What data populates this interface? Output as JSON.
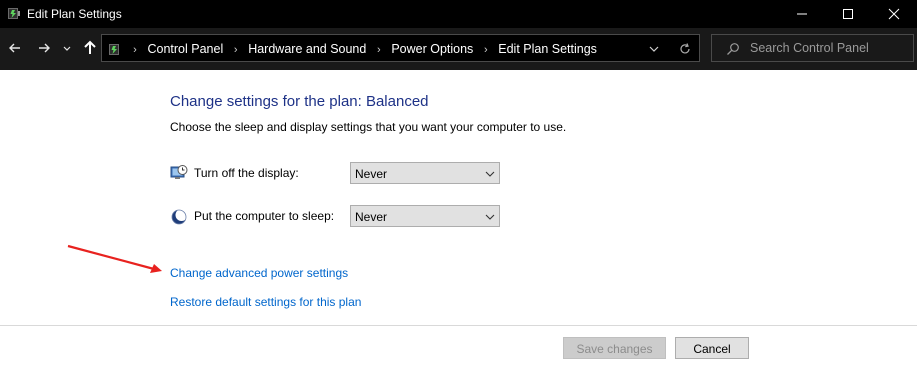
{
  "window": {
    "title": "Edit Plan Settings",
    "icons": {
      "app": "power-options-icon",
      "minimize": "minimize-icon",
      "maximize": "maximize-icon",
      "close": "close-icon"
    }
  },
  "nav": {
    "icons": [
      "back-arrow-icon",
      "forward-arrow-icon",
      "chevron-down-icon",
      "up-arrow-icon"
    ],
    "breadcrumbs": [
      "Control Panel",
      "Hardware and Sound",
      "Power Options",
      "Edit Plan Settings"
    ],
    "search_placeholder": "Search Control Panel"
  },
  "content": {
    "heading": "Change settings for the plan: Balanced",
    "subtext": "Choose the sleep and display settings that you want your computer to use.",
    "settings": [
      {
        "label": "Turn off the display:",
        "value": "Never",
        "icon": "monitor-clock-icon"
      },
      {
        "label": "Put the computer to sleep:",
        "value": "Never",
        "icon": "moon-sleep-icon"
      }
    ],
    "links": {
      "advanced": "Change advanced power settings",
      "restore": "Restore default settings for this plan"
    }
  },
  "buttons": {
    "save": "Save changes",
    "cancel": "Cancel"
  },
  "colors": {
    "heading": "#1e3287",
    "link": "#0066cc",
    "annotation_arrow": "#e8221f",
    "titlebar": "#000000",
    "navbar": "#191919"
  }
}
